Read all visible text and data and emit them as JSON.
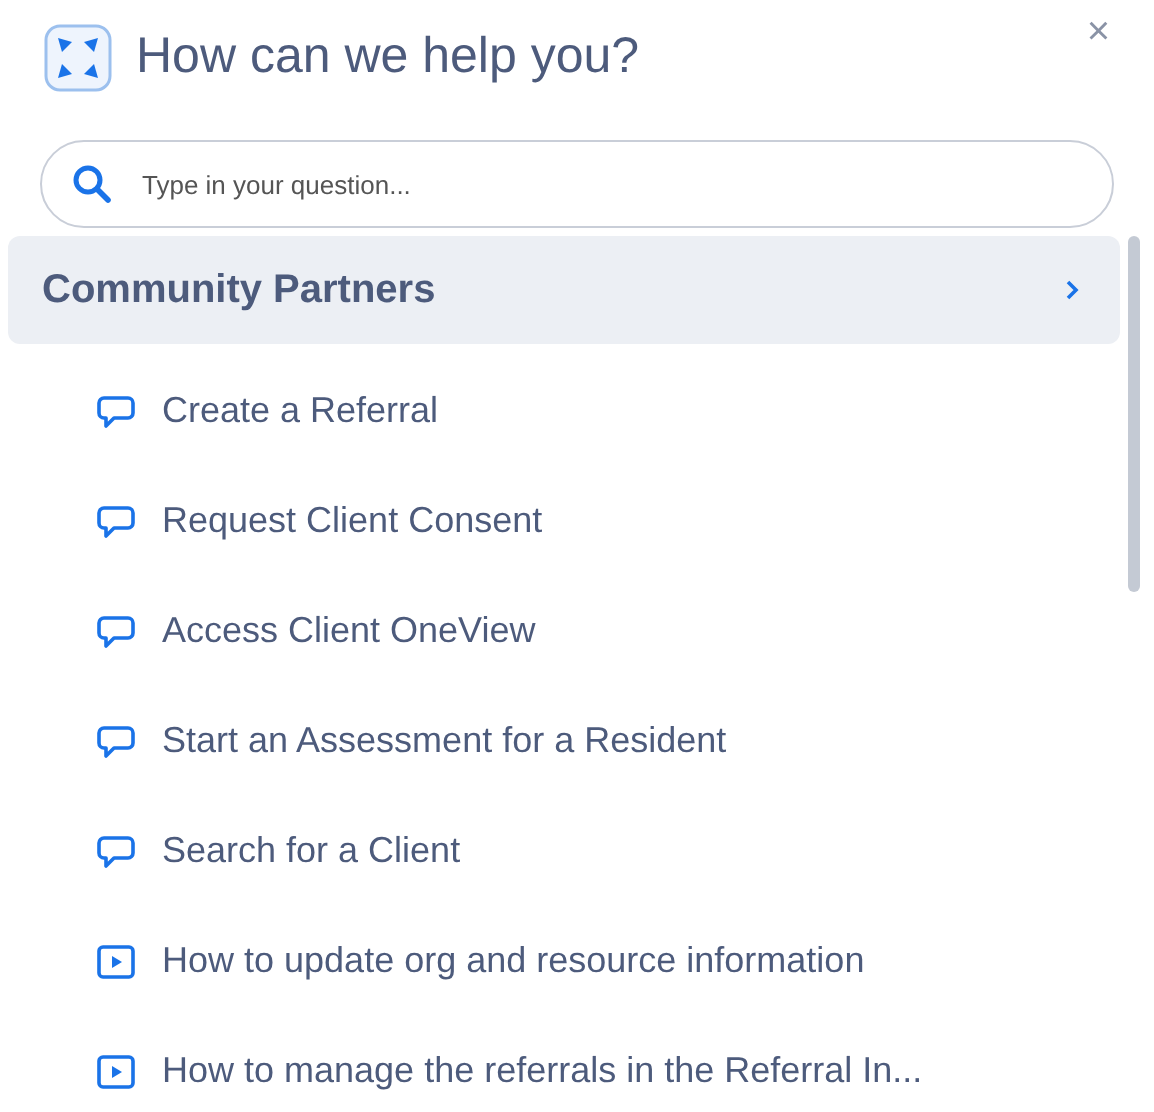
{
  "header": {
    "title": "How can we help you?",
    "close": "×"
  },
  "search": {
    "placeholder": "Type in your question..."
  },
  "category": {
    "title": "Community Partners"
  },
  "items": [
    {
      "kind": "article",
      "label": "Create a Referral"
    },
    {
      "kind": "article",
      "label": "Request Client Consent"
    },
    {
      "kind": "article",
      "label": "Access Client OneView"
    },
    {
      "kind": "article",
      "label": "Start an Assessment for a Resident"
    },
    {
      "kind": "article",
      "label": "Search for a Client"
    },
    {
      "kind": "video",
      "label": "How to update org and resource information"
    },
    {
      "kind": "video",
      "label": "How to manage the referrals in the Referral In..."
    }
  ]
}
